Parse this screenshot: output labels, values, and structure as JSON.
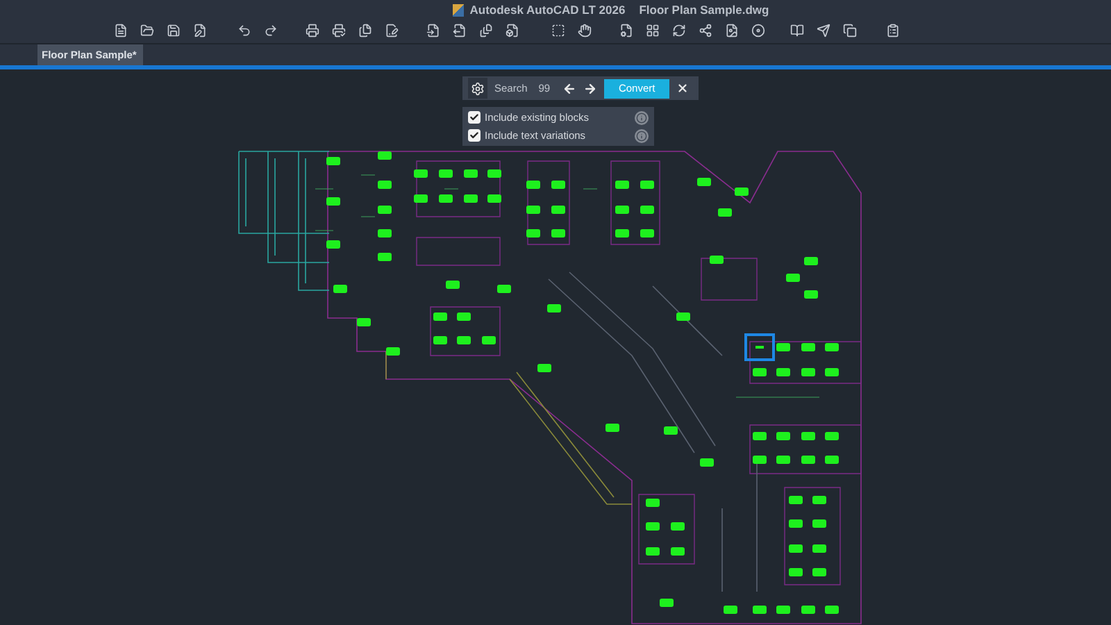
{
  "window": {
    "app_title": "Autodesk AutoCAD LT 2026",
    "document_title": "Floor Plan Sample.dwg"
  },
  "tabs": [
    {
      "label": "Floor Plan Sample*",
      "selected": true
    }
  ],
  "search_bar": {
    "label": "Search",
    "count": "99",
    "convert_button": "Convert"
  },
  "options": [
    {
      "label": "Include existing blocks",
      "checked": true
    },
    {
      "label": "Include text variations",
      "checked": true
    }
  ]
}
